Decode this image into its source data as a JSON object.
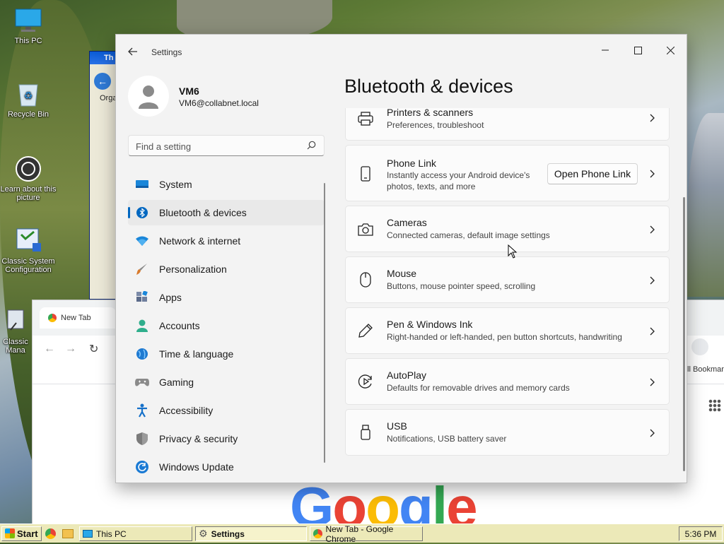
{
  "desktop": {
    "icons": [
      {
        "label": "This PC"
      },
      {
        "label": "Recycle Bin"
      },
      {
        "label": "Learn about this picture"
      },
      {
        "label": "Classic System Configuration"
      },
      {
        "label": "Classic Mana"
      }
    ]
  },
  "background_windows": {
    "explorer_title": "Th",
    "explorer_toolbar": "Orga",
    "chrome_tab": "New Tab",
    "chrome_bookmarks": "ll Bookmark",
    "google_logo": "Google"
  },
  "settings": {
    "window_title": "Settings",
    "user": {
      "name": "VM6",
      "email": "VM6@collabnet.local"
    },
    "search": {
      "placeholder": "Find a setting"
    },
    "nav": [
      {
        "label": "System",
        "icon": "system-icon",
        "color": "#0f6cbd"
      },
      {
        "label": "Bluetooth & devices",
        "icon": "bluetooth-icon",
        "color": "#0067c0",
        "active": true
      },
      {
        "label": "Network & internet",
        "icon": "wifi-icon",
        "color": "#1a86d9"
      },
      {
        "label": "Personalization",
        "icon": "brush-icon",
        "color": "#d97a2b"
      },
      {
        "label": "Apps",
        "icon": "apps-icon",
        "color": "#5b6b8a"
      },
      {
        "label": "Accounts",
        "icon": "accounts-icon",
        "color": "#2fae8c"
      },
      {
        "label": "Time & language",
        "icon": "globe-icon",
        "color": "#1f7ad1"
      },
      {
        "label": "Gaming",
        "icon": "gamepad-icon",
        "color": "#7a7a7a"
      },
      {
        "label": "Accessibility",
        "icon": "accessibility-icon",
        "color": "#1570c9"
      },
      {
        "label": "Privacy & security",
        "icon": "shield-icon",
        "color": "#6b6b6b"
      },
      {
        "label": "Windows Update",
        "icon": "update-icon",
        "color": "#1a7ad4"
      }
    ],
    "page_title": "Bluetooth & devices",
    "cards": [
      {
        "title": "Printers & scanners",
        "subtitle": "Preferences, troubleshoot",
        "icon": "printer-icon"
      },
      {
        "title": "Phone Link",
        "subtitle": "Instantly access your Android device's",
        "subtitle2": "photos, texts, and more",
        "icon": "phone-icon",
        "button": "Open Phone Link"
      },
      {
        "title": "Cameras",
        "subtitle": "Connected cameras, default image settings",
        "icon": "camera-icon"
      },
      {
        "title": "Mouse",
        "subtitle": "Buttons, mouse pointer speed, scrolling",
        "icon": "mouse-icon"
      },
      {
        "title": "Pen & Windows Ink",
        "subtitle": "Right-handed or left-handed, pen button shortcuts, handwriting",
        "icon": "pen-icon"
      },
      {
        "title": "AutoPlay",
        "subtitle": "Defaults for removable drives and memory cards",
        "icon": "autoplay-icon"
      },
      {
        "title": "USB",
        "subtitle": "Notifications, USB battery saver",
        "icon": "usb-icon"
      }
    ]
  },
  "taskbar": {
    "start": "Start",
    "items": [
      {
        "label": "This PC"
      },
      {
        "label": "Settings",
        "pressed": true
      },
      {
        "label": "New Tab - Google Chrome"
      }
    ],
    "clock": "5:36 PM"
  }
}
